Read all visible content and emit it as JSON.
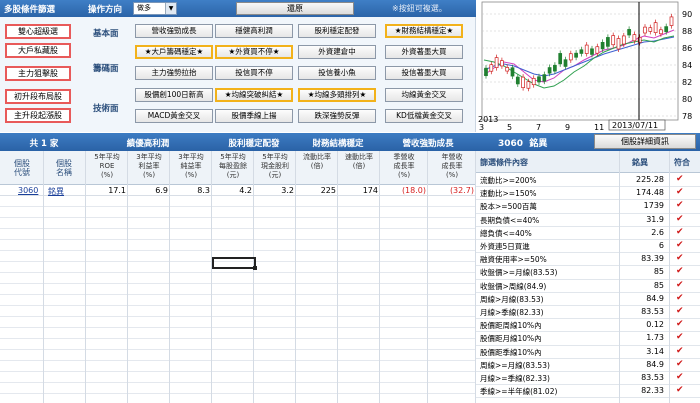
{
  "header": {
    "title": "多股條件篩選",
    "op_direction_label": "操作方向",
    "direction_value": "做多",
    "reset_label": "還原",
    "multi_select_note": "※按鈕可複選。"
  },
  "side_buttons": [
    "雙心超級選",
    "大戶私藏股",
    "主力狙擊股",
    "初升段布局股",
    "主升段起漲股"
  ],
  "categories": {
    "basic": "基本面",
    "chips": "籌碼面",
    "technical": "技術面"
  },
  "buttons": {
    "basic": [
      "營收強勁成長",
      "穩健高利潤",
      "股利穩定配發",
      "★財務結構穩定★"
    ],
    "chips_row1": [
      "★大戶籌碼穩定★",
      "★外資買不停★",
      "外資建倉中",
      "外資著墨大買"
    ],
    "chips_row2": [
      "主力強勢拉抬",
      "投信買不停",
      "投信養小魚",
      "投信著墨大買"
    ],
    "tech_row1": [
      "股價創100日新高",
      "★均線突破糾結★",
      "★均線多頭排列★",
      "均線黃金交叉"
    ],
    "tech_row2": [
      "MACD黃金交叉",
      "股價季線上揚",
      "跌深強勢反彈",
      "KD低檔黃金交叉"
    ]
  },
  "chart": {
    "y_ticks": [
      "90",
      "88",
      "86",
      "84",
      "82",
      "80",
      "78"
    ],
    "x_ticks": [
      "3",
      "5",
      "7",
      "9",
      "11",
      "1",
      "3"
    ],
    "year_label": "2013",
    "date_marker": "2013/07/11"
  },
  "table": {
    "count_label": "共 1 家",
    "groups": [
      "績優高利潤",
      "股利穩定配發",
      "財務結構穩定",
      "營收強勁成長"
    ],
    "columns": [
      "個股\n代號",
      "個股\n名稱",
      "5年平均\nROE\n(%)",
      "3年平均\n利益率\n(%)",
      "3年平均\n純益率\n(%)",
      "5年平均\n每股盈餘\n(元)",
      "5年平均\n現金股利\n(元)",
      "流動比率\n(倍)",
      "速動比率\n(倍)",
      "季營收\n成長率\n(%)",
      "年營收\n成長率\n(%)"
    ],
    "rows": [
      {
        "code": "3060",
        "name": "銘異",
        "roe": "17.1",
        "profit_margin": "6.9",
        "net_margin": "8.3",
        "eps": "4.2",
        "cash_div": "3.2",
        "current_ratio": "225",
        "quick_ratio": "174",
        "q_rev_growth": "(18.0)",
        "y_rev_growth": "(32.7)"
      }
    ]
  },
  "right_panel": {
    "stock_code": "3060",
    "stock_name": "銘異",
    "detail_button": "個股詳細資訊",
    "cond_head_label": "篩選條件內容",
    "cond_head_stock": "銘異",
    "cond_head_match": "符合",
    "check_mark": "✔",
    "conditions": [
      {
        "label": "流動比>=200%",
        "value": "225.28"
      },
      {
        "label": "速動比>=150%",
        "value": "174.48"
      },
      {
        "label": "股本>=500百萬",
        "value": "1739"
      },
      {
        "label": "長期負債<=40%",
        "value": "31.9"
      },
      {
        "label": "總負債<=40%",
        "value": "2.6"
      },
      {
        "label": "外資連5日買進",
        "value": "6"
      },
      {
        "label": "融資使用率>=50%",
        "value": "83.39"
      },
      {
        "label": "收盤價>=月線(83.53)",
        "value": "85"
      },
      {
        "label": "收盤價>周線(84.9)",
        "value": "85"
      },
      {
        "label": "周線>月線(83.53)",
        "value": "84.9"
      },
      {
        "label": "月線>季線(82.33)",
        "value": "83.53"
      },
      {
        "label": "股價距周線10%內",
        "value": "0.12"
      },
      {
        "label": "股價距月線10%內",
        "value": "1.73"
      },
      {
        "label": "股價距季線10%內",
        "value": "3.14"
      },
      {
        "label": "周線>=月線(83.53)",
        "value": "84.9"
      },
      {
        "label": "月線>=季線(82.33)",
        "value": "83.53"
      },
      {
        "label": "季線>=半年線(81.02)",
        "value": "82.33"
      }
    ]
  }
}
